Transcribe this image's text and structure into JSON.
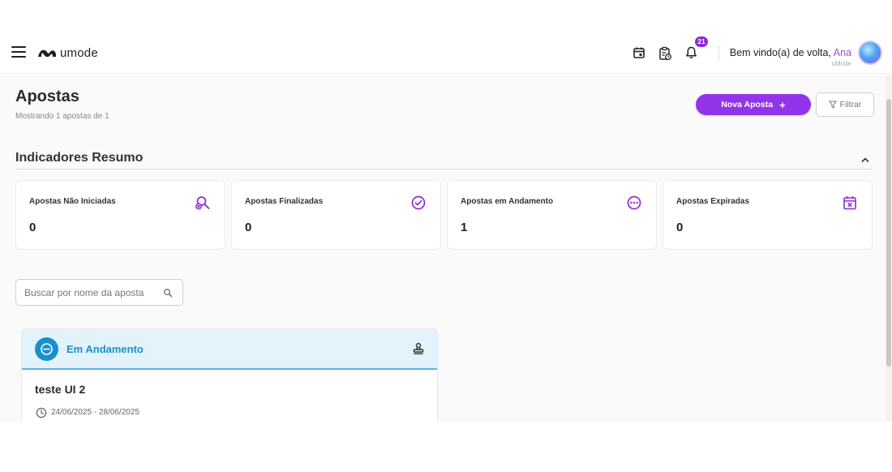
{
  "app": {
    "logo_text": "umode"
  },
  "header": {
    "notification_count": "21",
    "welcome_text": "Bem vindo(a) de volta, ",
    "user_name": "Ana",
    "company": "uMode"
  },
  "page": {
    "title": "Apostas",
    "subtitle": "Mostrando 1 apostas de 1",
    "new_button_label": "Nova Aposta",
    "new_button_plus": "+",
    "filter_button_label": "Filtrar"
  },
  "summary": {
    "title": "Indicadores Resumo",
    "cards": [
      {
        "label": "Apostas Não Iniciadas",
        "value": "0",
        "icon": "search-cancel-icon"
      },
      {
        "label": "Apostas Finalizadas",
        "value": "0",
        "icon": "check-circle-icon"
      },
      {
        "label": "Apostas em Andamento",
        "value": "1",
        "icon": "dots-circle-icon"
      },
      {
        "label": "Apostas Expiradas",
        "value": "0",
        "icon": "calendar-x-icon"
      }
    ]
  },
  "search": {
    "placeholder": "Buscar por nome da aposta"
  },
  "bets": [
    {
      "status": "Em Andamento",
      "name": "teste UI 2",
      "dates": "24/06/2025 - 28/06/2025"
    }
  ],
  "colors": {
    "accent": "#9333ea",
    "status_in_progress": "#1a8fd0",
    "status_header_bg": "#e3f3fb"
  }
}
